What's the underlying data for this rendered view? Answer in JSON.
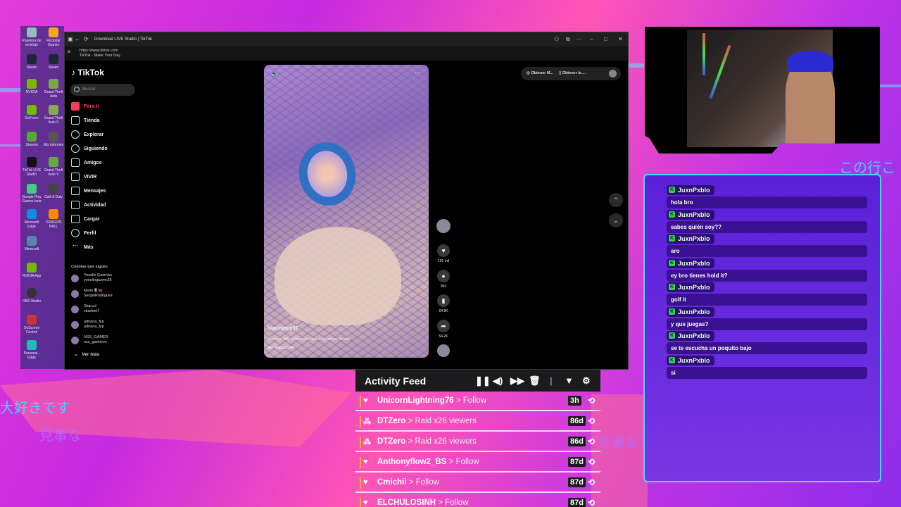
{
  "browser": {
    "tab_title": "Download LIVE Studio | TikTok",
    "url": "https://www.tiktok.com",
    "page_title": "TikTok - Make Your Day"
  },
  "desktop": {
    "icons": [
      "Papelera de reciclaje",
      "Rockstar Games",
      "Steam",
      "Steam",
      "NVIDIA",
      "Grand Theft Auto",
      "GeForce",
      "Grand Theft Auto V",
      "Stremio",
      "Mis informes",
      "TikTok LIVE Studio",
      "Grand Theft Auto V",
      "Google Play Games beta",
      "Call of Duty",
      "Microsoft Edge",
      "DRAGON BALL",
      "Minecraft",
      "",
      "NVIDIA App",
      "",
      "OBS Studio",
      "",
      "OnScreen Control",
      "",
      "Personal - Edge",
      ""
    ]
  },
  "tiktok": {
    "logo": "TikTok",
    "search_placeholder": "Buscar",
    "nav": [
      "Para ti",
      "Tienda",
      "Explorar",
      "Siguiendo",
      "Amigos",
      "VIVIR",
      "Mensajes",
      "Actividad",
      "Cargar",
      "Perfil",
      "Más"
    ],
    "following_label": "Cuentas que sigues",
    "following": [
      {
        "name": "Yoselin Guzmán",
        "handle": "yoselinguzmn25"
      },
      {
        "name": "Mvrie🌷🦋",
        "handle": "SergioRodriguez"
      },
      {
        "name": "Skar🏎",
        "handle": "skarleet7"
      },
      {
        "name": "adriana_fyp",
        "handle": "adriana_fyp"
      },
      {
        "name": "NSS_GAMER",
        "handle": "nss_gamervx"
      }
    ],
    "see_more": "Ver más",
    "top_buttons": [
      "Obtener M...",
      "Obtener la ..."
    ],
    "video": {
      "author": "bapbaptop97",
      "caption": "Consejo #diy #lifehacks #tips #diyproject #crafts",
      "translate": "Ver traducción"
    },
    "counts": {
      "likes": "191 mil",
      "comments": "901",
      "saves": "64.6K",
      "shares": "54.2K"
    }
  },
  "overlay": {
    "jp_top": "この行こ",
    "jp_left": "大好きです",
    "jp_mid": "見事な",
    "jp_right": "見事な"
  },
  "chat": {
    "messages": [
      {
        "user": "JuxnPxblo",
        "text": "hola bro"
      },
      {
        "user": "JuxnPxblo",
        "text": "sabes quién soy??"
      },
      {
        "user": "JuxnPxblo",
        "text": "aro"
      },
      {
        "user": "JuxnPxblo",
        "text": "ey bro tienes hold it?"
      },
      {
        "user": "JuxnPxblo",
        "text": "golf it"
      },
      {
        "user": "JuxnPxblo",
        "text": "y que juegas?"
      },
      {
        "user": "JuxnPxblo",
        "text": "se te escucha un poquito bajo"
      },
      {
        "user": "JuxnPxblo",
        "text": "si"
      }
    ]
  },
  "activity_feed": {
    "title": "Activity Feed",
    "rows": [
      {
        "user": "UnicornLightning76",
        "action": "> Follow",
        "age": "3h",
        "icon": "heart-icon"
      },
      {
        "user": "DTZero",
        "action": "> Raid x26 viewers",
        "age": "86d",
        "icon": "raid-icon"
      },
      {
        "user": "DTZero",
        "action": "> Raid x26 viewers",
        "age": "86d",
        "icon": "raid-icon"
      },
      {
        "user": "Anthonyflow2_BS",
        "action": "> Follow",
        "age": "87d",
        "icon": "heart-icon"
      },
      {
        "user": "Cmichii",
        "action": "> Follow",
        "age": "87d",
        "icon": "heart-icon"
      },
      {
        "user": "ELCHULOSINH",
        "action": "> Follow",
        "age": "87d",
        "icon": "heart-icon"
      }
    ]
  },
  "colors": {
    "accent_red": "#ff3b5c",
    "chat_border": "#49d8ff",
    "mod_badge": "#2ad44b",
    "feed_bar": "#ffb02e"
  }
}
